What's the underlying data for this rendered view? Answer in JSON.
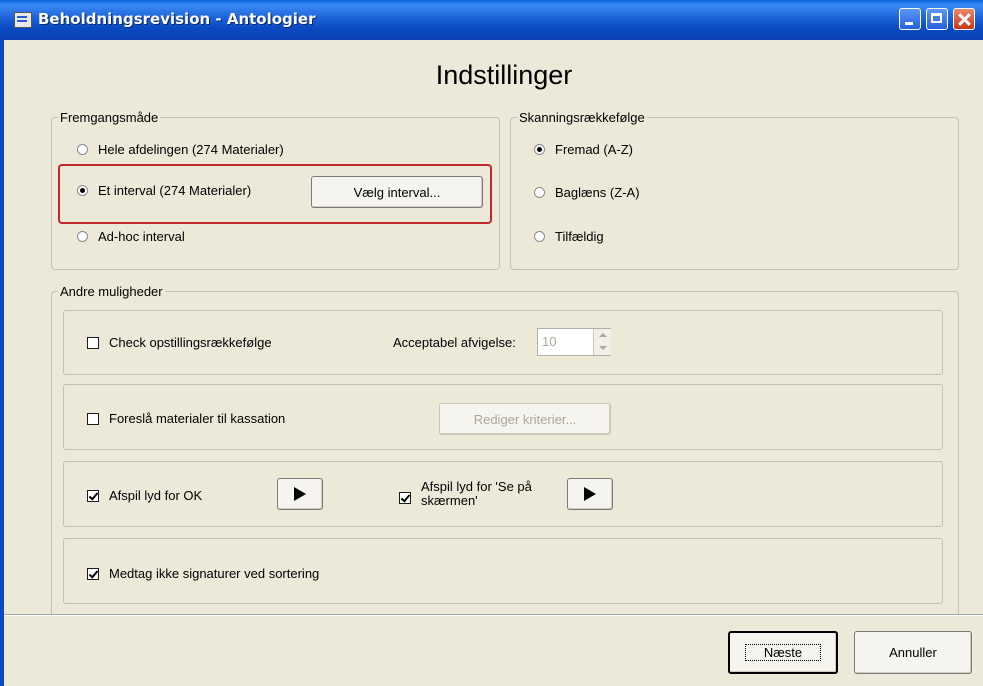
{
  "window": {
    "title": "Beholdningsrevision - Antologier"
  },
  "heading": "Indstillinger",
  "fremgangsmaade": {
    "legend": "Fremgangsmåde",
    "options": [
      {
        "label": "Hele afdelingen (274 Materialer)",
        "selected": false
      },
      {
        "label": "Et interval (274 Materialer)",
        "selected": true
      },
      {
        "label": "Ad-hoc interval",
        "selected": false
      }
    ],
    "interval_button": "Vælg interval..."
  },
  "skanning": {
    "legend": "Skanningsrækkefølge",
    "options": [
      {
        "label": "Fremad (A-Z)",
        "selected": true
      },
      {
        "label": "Baglæns (Z-A)",
        "selected": false
      },
      {
        "label": "Tilfældig",
        "selected": false
      }
    ]
  },
  "andre": {
    "legend": "Andre muligheder",
    "check_order": {
      "label": "Check opstillingsrækkefølge",
      "checked": false
    },
    "deviation": {
      "label": "Acceptabel afvigelse:",
      "value": "10"
    },
    "suggest_discard": {
      "label": "Foreslå materialer til kassation",
      "checked": false
    },
    "edit_criteria": "Rediger kriterier...",
    "sound_ok": {
      "label": "Afspil lyd for OK",
      "checked": true
    },
    "sound_screen": {
      "label_line1": "Afspil lyd for 'Se på",
      "label_line2": "skærmen'",
      "checked": true
    },
    "exclude_signatures": {
      "label": "Medtag ikke signaturer ved sortering",
      "checked": true
    }
  },
  "footer": {
    "next": "Næste",
    "cancel": "Annuller"
  },
  "colors": {
    "highlight": "#c0282e",
    "titlebar": "#0a4ac2",
    "dialog_bg": "#ece9d8"
  }
}
